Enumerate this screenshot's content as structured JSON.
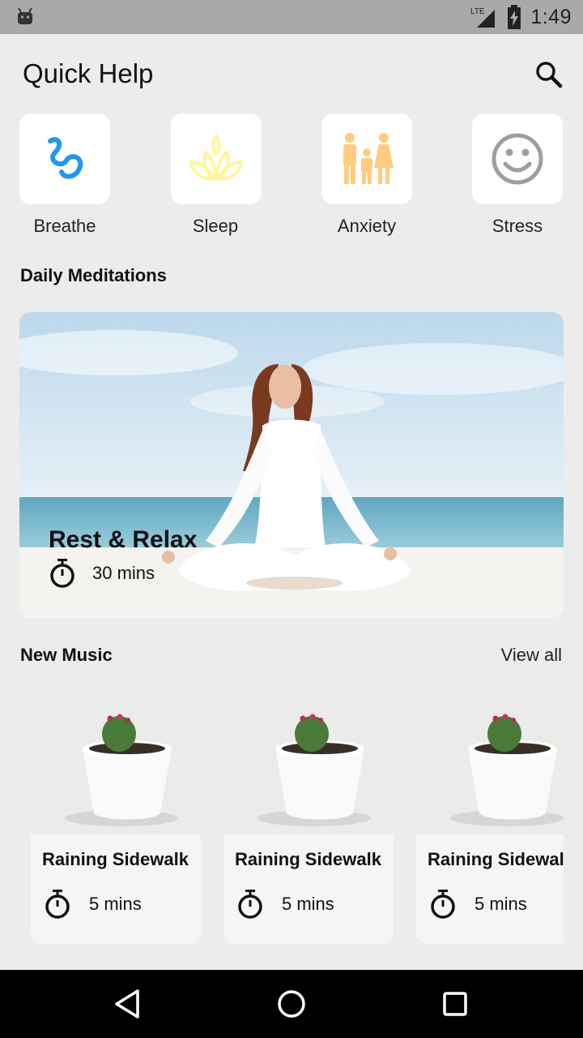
{
  "status_bar": {
    "time": "1:49",
    "network": "LTE"
  },
  "header": {
    "title": "Quick Help",
    "search_icon": "search-icon"
  },
  "quick_help": [
    {
      "label": "Breathe",
      "icon": "breathe-icon",
      "color": "#2196f3"
    },
    {
      "label": "Sleep",
      "icon": "lotus-icon",
      "color": "#fff59d"
    },
    {
      "label": "Anxiety",
      "icon": "family-icon",
      "color": "#ffcc80"
    },
    {
      "label": "Stress",
      "icon": "smiley-icon",
      "color": "#9e9e9e"
    }
  ],
  "daily_meditations": {
    "title": "Daily Meditations",
    "featured": {
      "title": "Rest & Relax",
      "duration": "30 mins"
    }
  },
  "new_music": {
    "title": "New Music",
    "view_all": "View all",
    "items": [
      {
        "title": "Raining Sidewalk",
        "duration": "5 mins"
      },
      {
        "title": "Raining Sidewalk",
        "duration": "5 mins"
      },
      {
        "title": "Raining Sidewalk",
        "duration": "5 mins"
      }
    ]
  },
  "nav_bar": {
    "back": "back-icon",
    "home": "home-icon",
    "recents": "recents-icon"
  },
  "colors": {
    "background": "#ececec",
    "status_bar": "#a9a9a9",
    "nav_bar": "#000000",
    "card": "#ffffff"
  }
}
